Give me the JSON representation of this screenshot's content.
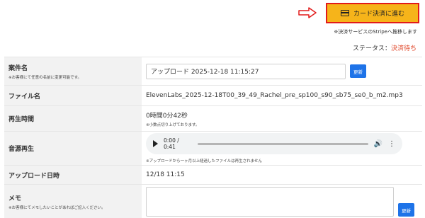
{
  "header": {
    "pay_button_label": "カード決済に進む",
    "stripe_note": "※決済サービスのStripeへ推移します",
    "status_label": "ステータス：",
    "status_value": "決済待ち"
  },
  "colors": {
    "pay_button_bg": "#f6b41a",
    "pay_button_border": "#e21b1b",
    "arrow": "#e21b1b",
    "status_value": "#e0492c",
    "update_button": "#1e73e8",
    "label_bg": "#f2f2f2"
  },
  "icons": {
    "arrow": "right-arrow-icon",
    "card": "credit-card-icon",
    "play": "play-icon",
    "volume": "volume-icon",
    "menu": "more-vertical-icon"
  },
  "form": {
    "case_name": {
      "label": "案件名",
      "note": "※お客様にて任意の名前に変更可能です。",
      "value": "アップロード 2025-12-18 11:15:27",
      "update_label": "更新"
    },
    "file_name": {
      "label": "ファイル名",
      "value": "ElevenLabs_2025-12-18T00_39_49_Rachel_pre_sp100_s90_sb75_se0_b_m2.mp3"
    },
    "play_time": {
      "label": "再生時間",
      "value": "0時間0分42秒",
      "note": "※小数点切り上げております。"
    },
    "audio": {
      "label": "音源再生",
      "time": "0:00 / 0:41",
      "progress": 0.0,
      "note": "※アップロードから一ヶ月以上経過したファイルは再生されません"
    },
    "upload_date": {
      "label": "アップロード日時",
      "value": "12/18 11:15"
    },
    "memo": {
      "label": "メモ",
      "note": "※お客様にてメモしたいことがあればご記入ください。",
      "value": "",
      "update_label": "更新"
    }
  }
}
